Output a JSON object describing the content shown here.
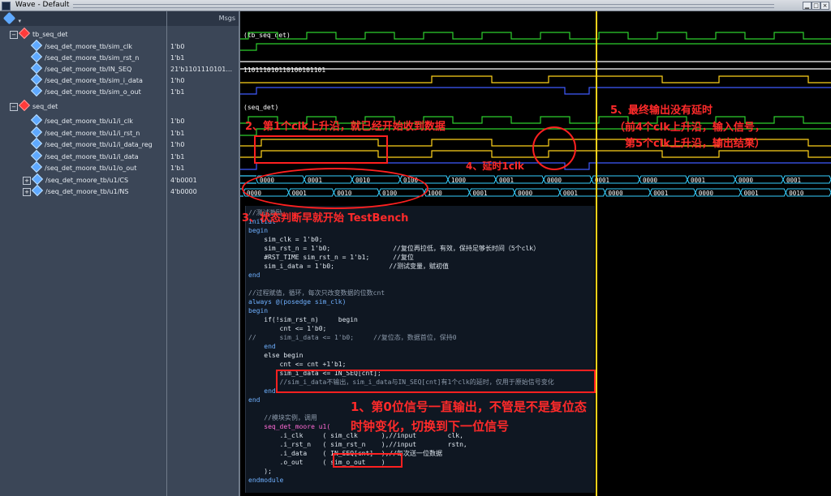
{
  "window": {
    "title": "Wave - Default"
  },
  "header": {
    "msgs_label": "Msgs"
  },
  "groups": [
    {
      "name": "tb_seq_det",
      "label": "(tb_seq_det)"
    },
    {
      "name": "seq_det",
      "label": "(seq_det)"
    }
  ],
  "signals": [
    {
      "name": "/seq_det_moore_tb/sim_clk",
      "value": "1'b0"
    },
    {
      "name": "/seq_det_moore_tb/sim_rst_n",
      "value": "1'b1"
    },
    {
      "name": "/seq_det_moore_tb/IN_SEQ",
      "value": "21'b1101110101..."
    },
    {
      "name": "/seq_det_moore_tb/sim_i_data",
      "value": "1'h0"
    },
    {
      "name": "/seq_det_moore_tb/sim_o_out",
      "value": "1'b1"
    },
    {
      "name": "/seq_det_moore_tb/u1/i_clk",
      "value": "1'b0"
    },
    {
      "name": "/seq_det_moore_tb/u1/i_rst_n",
      "value": "1'b1"
    },
    {
      "name": "/seq_det_moore_tb/u1/i_data_reg",
      "value": "1'h0"
    },
    {
      "name": "/seq_det_moore_tb/u1/i_data",
      "value": "1'b1"
    },
    {
      "name": "/seq_det_moore_tb/u1/o_out",
      "value": "1'b1"
    },
    {
      "name": "/seq_det_moore_tb/u1/CS",
      "value": "4'b0001"
    },
    {
      "name": "/seq_det_moore_tb/u1/NS",
      "value": "4'b0000"
    }
  ],
  "waves": {
    "in_seq_value": "110111010110100101101",
    "cs_values": [
      "0000",
      "0001",
      "0010",
      "0100",
      "1000",
      "0001",
      "0000",
      "0001",
      "0000",
      "0001",
      "0000",
      "0001"
    ],
    "ns_values": [
      "0000",
      "0001",
      "0010",
      "0100",
      "1000",
      "0001",
      "0000",
      "0001",
      "0000",
      "0001",
      "0000",
      "0001",
      "0010"
    ]
  },
  "code": {
    "lines": [
      "//测试激励",
      "initial",
      "begin",
      "    sim_clk = 1'b0;",
      "    sim_rst_n = 1'b0;                //复位再拉低，有效，保持足够长时间（5个clk）",
      "    #RST_TIME sim_rst_n = 1'b1;      //复位",
      "    sim_i_data = 1'b0;              //测试变量，赋初值",
      "end",
      "",
      "//过程赋值，循环，每次只改变数据的位数cnt",
      "always @(posedge sim_clk)",
      "begin",
      "    if(!sim_rst_n)     begin",
      "        cnt <= 1'b0;",
      "//      sim_i_data <= 1'b0;     //复位态，数据首位，保持0",
      "    end",
      "    else begin",
      "        cnt <= cnt +1'b1;",
      "        sim_i_data <= IN_SEQ[cnt];",
      "        //sim_i_data不输出，sim_i_data与IN_SEQ[cnt]有1个clk的延时，仅用于原始信号变化",
      "    end",
      "end",
      "",
      "    //模块实例，调用",
      "    seq_det_moore u1(",
      "        .i_clk     ( sim_clk      ),//input        clk,",
      "        .i_rst_n   ( sim_rst_n    ),//input        rstn,",
      "        .i_data    ( IN_SEQ[cnt]  ),//每次送一位数据",
      "        .o_out     ( sim_o_out    )",
      "    );",
      "endmodule"
    ]
  },
  "annotations": {
    "a1_line1": "1、第0位信号一直输出，不管是不是复位态",
    "a1_line2": "时钟变化，切换到下一位信号",
    "a2": "2、第1个clk上升沿，就已经开始收到数据",
    "a3": "3、状态判断早就开始 TestBench",
    "a4": "4、延时1clk",
    "a5_line1": "5、最终输出没有延时",
    "a5_line2": "（前4个clk上升沿，输入信号，",
    "a5_line3": "第5个clk上升沿，输出结果）"
  },
  "colors": {
    "clk": "#2ecf2e",
    "logic": "#ffd21a",
    "bus": "#36d0ff",
    "seq": "#ffffff",
    "out": "#3f5bff",
    "annotation": "#ff2020"
  }
}
